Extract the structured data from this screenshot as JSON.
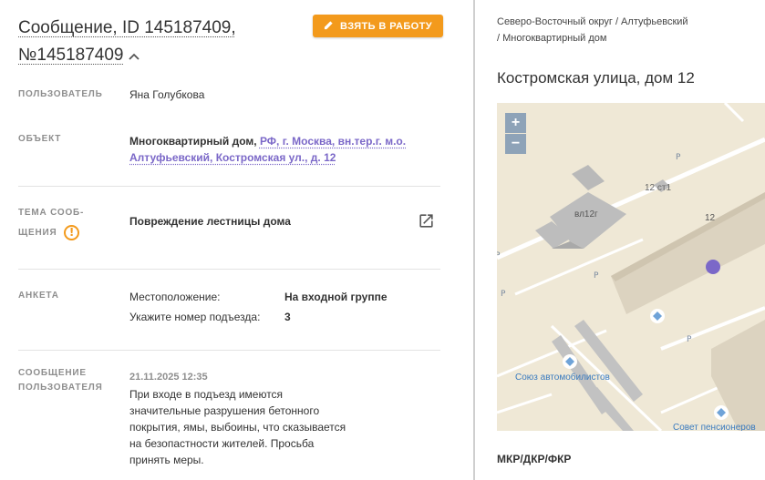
{
  "header": {
    "title_line1": "Сообщение, ID 145187409,",
    "title_line2": "№145187409",
    "take_button": "ВЗЯТЬ В РАБОТУ"
  },
  "fields": {
    "user_label": "ПОЛЬЗОВАТЕЛЬ",
    "user_value": "Яна Голубкова",
    "object_label": "ОБЪЕКТ",
    "object_type": "Многоквартирный дом,",
    "object_link_line1": "РФ, г. Москва, вн.тер.г. м.о.",
    "object_link_line2": "Алтуфьевский, Костромская ул., д. 12",
    "topic_label_line1": "ТЕМА СООБ-",
    "topic_label_line2": "ЩЕНИЯ",
    "topic_value": "Повреждение лестницы дома",
    "form_label": "АНКЕТА",
    "form_rows": [
      {
        "q": "Местоположение:",
        "a": "На входной группе"
      },
      {
        "q": "Укажите номер подъезда:",
        "a": "3"
      }
    ],
    "msg_label_line1": "СООБЩЕНИЕ",
    "msg_label_line2": "ПОЛЬЗОВАТЕЛЯ",
    "msg_date": "21.11.2025 12:35",
    "msg_lines": [
      "При входе в подъезд имеются",
      "значительные разрушения бетонного",
      "покрытия, ямы, выбоины, что сказывается",
      "на безопастности жителей. Просьба",
      "принять меры."
    ]
  },
  "right": {
    "breadcrumb_line1": "Северо-Восточный округ / Алтуфьевский",
    "breadcrumb_line2": "/ Многоквартирный дом",
    "address": "Костромская улица, дом 12",
    "zoom_in": "+",
    "zoom_out": "−",
    "bottom_label": "МКР/ДКР/ФКР"
  },
  "map": {
    "labels": [
      "вл12г",
      "12 ст1",
      "12",
      "Союз автомобилистов",
      "Совет пенсионеров"
    ],
    "parking": "P"
  },
  "colors": {
    "accent_orange": "#f39a1c",
    "link_purple": "#7b68c8",
    "map_bg": "#efe8d6",
    "map_marker": "#7b68c8"
  }
}
